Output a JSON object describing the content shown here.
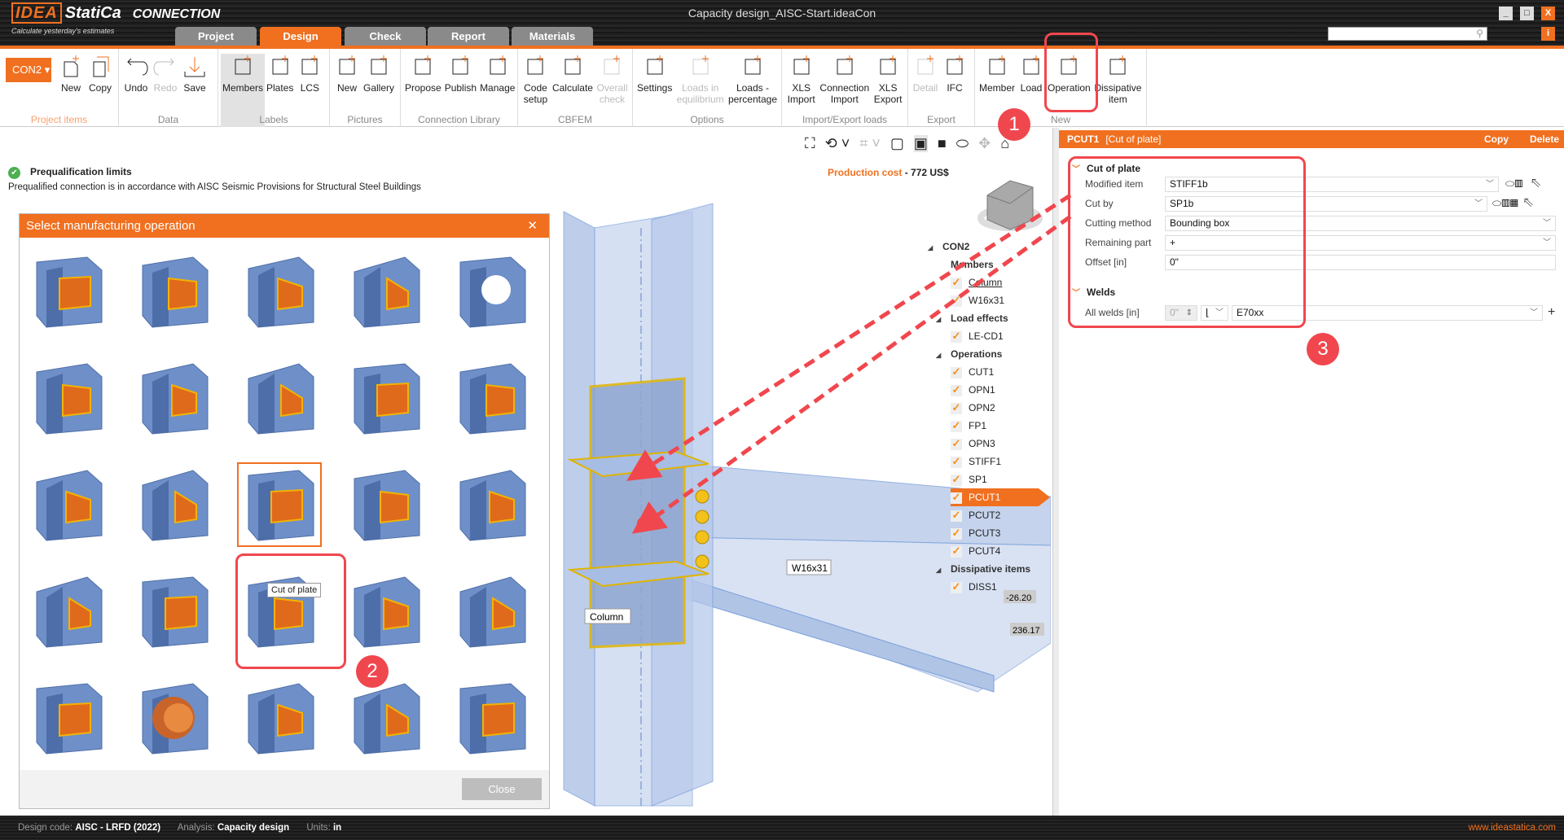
{
  "app": {
    "logo_text": "IDEA StatiCa",
    "product": "CONNECTION",
    "tagline": "Calculate yesterday's estimates",
    "window_title": "Capacity design_AISC-Start.ideaCon",
    "accent_color": "#f07020",
    "annotation_color": "#f0474e"
  },
  "tabs": [
    {
      "label": "Project"
    },
    {
      "label": "Design",
      "active": true
    },
    {
      "label": "Check"
    },
    {
      "label": "Report"
    },
    {
      "label": "Materials"
    }
  ],
  "window_controls": {
    "minimize": "_",
    "maximize": "□",
    "close": "X",
    "info": "i"
  },
  "search": {
    "placeholder": "",
    "icon": "search-icon"
  },
  "ribbon": {
    "connection_selector": "CON2",
    "groups": [
      {
        "label": "Project items",
        "buttons": [
          {
            "label": "New",
            "icon": "new-item-icon"
          },
          {
            "label": "Copy",
            "icon": "copy-icon"
          }
        ]
      },
      {
        "label": "Data",
        "buttons": [
          {
            "label": "Undo",
            "icon": "undo-icon"
          },
          {
            "label": "Redo",
            "icon": "redo-icon",
            "disabled": true
          },
          {
            "label": "Save",
            "icon": "save-icon"
          }
        ]
      },
      {
        "label": "Labels",
        "buttons": [
          {
            "label": "Members",
            "icon": "members-icon",
            "selected": true
          },
          {
            "label": "Plates",
            "icon": "plates-icon"
          },
          {
            "label": "LCS",
            "icon": "lcs-icon"
          }
        ]
      },
      {
        "label": "Pictures",
        "buttons": [
          {
            "label": "New",
            "icon": "new-picture-icon"
          },
          {
            "label": "Gallery",
            "icon": "gallery-icon"
          }
        ]
      },
      {
        "label": "Connection Library",
        "buttons": [
          {
            "label": "Propose",
            "icon": "propose-icon"
          },
          {
            "label": "Publish",
            "icon": "publish-icon"
          },
          {
            "label": "Manage",
            "icon": "manage-icon"
          }
        ]
      },
      {
        "label": "CBFEM",
        "buttons": [
          {
            "label": "Code setup",
            "icon": "code-setup-icon"
          },
          {
            "label": "Calculate",
            "icon": "calculate-icon"
          },
          {
            "label": "Overall check",
            "icon": "overall-check-icon",
            "disabled": true
          }
        ]
      },
      {
        "label": "Options",
        "buttons": [
          {
            "label": "Settings",
            "icon": "settings-icon"
          },
          {
            "label": "Loads in equilibrium",
            "icon": "loads-equilibrium-icon",
            "disabled": true
          },
          {
            "label": "Loads - percentage",
            "icon": "loads-percentage-icon"
          }
        ]
      },
      {
        "label": "Import/Export loads",
        "buttons": [
          {
            "label": "XLS Import",
            "icon": "xls-import-icon"
          },
          {
            "label": "Connection Import",
            "icon": "connection-import-icon"
          },
          {
            "label": "XLS Export",
            "icon": "xls-export-icon"
          }
        ]
      },
      {
        "label": "Export",
        "buttons": [
          {
            "label": "Detail",
            "icon": "detail-icon",
            "disabled": true
          },
          {
            "label": "IFC",
            "icon": "ifc-icon"
          }
        ]
      },
      {
        "label": "New",
        "buttons": [
          {
            "label": "Member",
            "icon": "member-add-icon"
          },
          {
            "label": "Load",
            "icon": "load-add-icon"
          },
          {
            "label": "Operation",
            "icon": "operation-add-icon"
          },
          {
            "label": "Dissipative item",
            "icon": "dissipative-add-icon"
          }
        ]
      }
    ]
  },
  "prequalification": {
    "title": "Prequalification limits",
    "text": "Prequalified connection is in accordance with AISC Seismic Provisions for Structural Steel Buildings",
    "status": "ok"
  },
  "production_cost": {
    "label": "Production cost",
    "separator": "-",
    "value": "772 US$"
  },
  "viewport": {
    "labels": {
      "column": "Column",
      "beam": "W16x31"
    },
    "values": [
      "-26.20",
      "236.17"
    ]
  },
  "tree": {
    "root": "CON2",
    "sections": [
      {
        "label": "Members",
        "items": [
          "Column",
          "W16x31"
        ]
      },
      {
        "label": "Load effects",
        "items": [
          "LE-CD1"
        ]
      },
      {
        "label": "Operations",
        "items": [
          "CUT1",
          "OPN1",
          "OPN2",
          "FP1",
          "OPN3",
          "STIFF1",
          "SP1",
          "PCUT1",
          "PCUT2",
          "PCUT3",
          "PCUT4"
        ]
      },
      {
        "label": "Dissipative items",
        "items": [
          "DISS1"
        ]
      }
    ],
    "selected": "PCUT1"
  },
  "properties": {
    "id": "PCUT1",
    "type": "[Cut of plate]",
    "copy": "Copy",
    "delete": "Delete",
    "section1": "Cut of plate",
    "rows": [
      {
        "label": "Modified item",
        "value": "STIFF1b"
      },
      {
        "label": "Cut by",
        "value": "SP1b"
      },
      {
        "label": "Cutting method",
        "value": "Bounding box"
      },
      {
        "label": "Remaining part",
        "value": "+"
      },
      {
        "label": "Offset [in]",
        "value": "0\""
      }
    ],
    "section2": "Welds",
    "welds": {
      "label": "All welds [in]",
      "size": "0\"",
      "material": "E70xx"
    }
  },
  "dialog": {
    "title": "Select manufacturing operation",
    "close_label": "Close",
    "tooltip": "Cut of plate",
    "highlighted_index": 12
  },
  "annotations": [
    "1",
    "2",
    "3"
  ],
  "statusbar": {
    "design_code_label": "Design code:",
    "design_code": "AISC - LRFD (2022)",
    "analysis_label": "Analysis:",
    "analysis": "Capacity design",
    "units_label": "Units:",
    "units": "in",
    "website": "www.ideastatica.com"
  }
}
